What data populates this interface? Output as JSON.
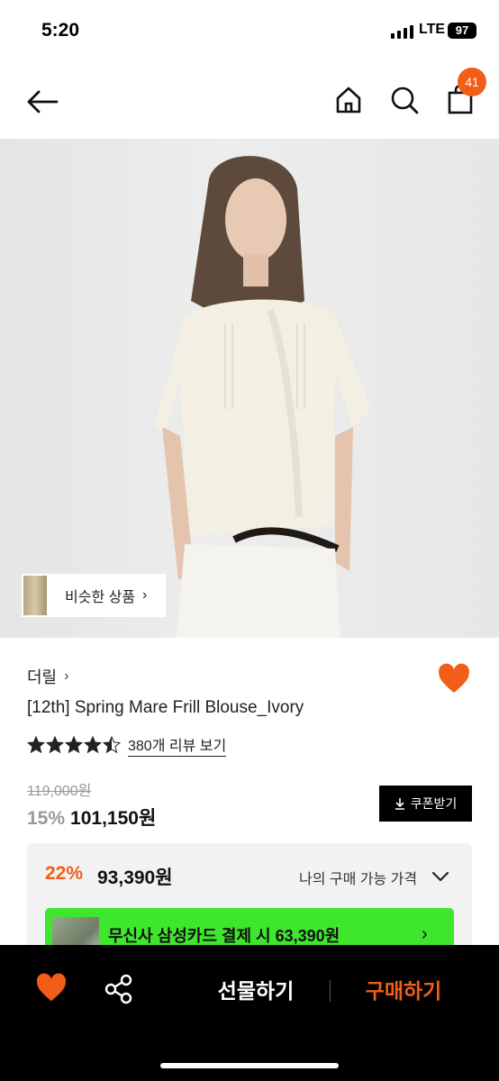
{
  "status_bar": {
    "time": "5:20",
    "network": "LTE",
    "battery": "97"
  },
  "header": {
    "cart_count": "41"
  },
  "similar": {
    "label": "비슷한 상품"
  },
  "product": {
    "brand": "더릴",
    "title": "[12th] Spring Mare Frill Blouse_Ivory",
    "rating": 4.5,
    "review_text": "380개 리뷰 보기",
    "original_price": "119,000원",
    "discount": "15%",
    "sale_price": "101,150원",
    "coupon_label": "쿠폰받기"
  },
  "best_price": {
    "discount": "22%",
    "price": "93,390원",
    "label": "나의 구매 가능 가격",
    "card_text": "무신사 삼성카드 결제 시 63,390원"
  },
  "bottom_bar": {
    "gift_label": "선물하기",
    "buy_label": "구매하기"
  },
  "colors": {
    "accent": "#f25d17",
    "card_banner": "#3fe62e"
  }
}
